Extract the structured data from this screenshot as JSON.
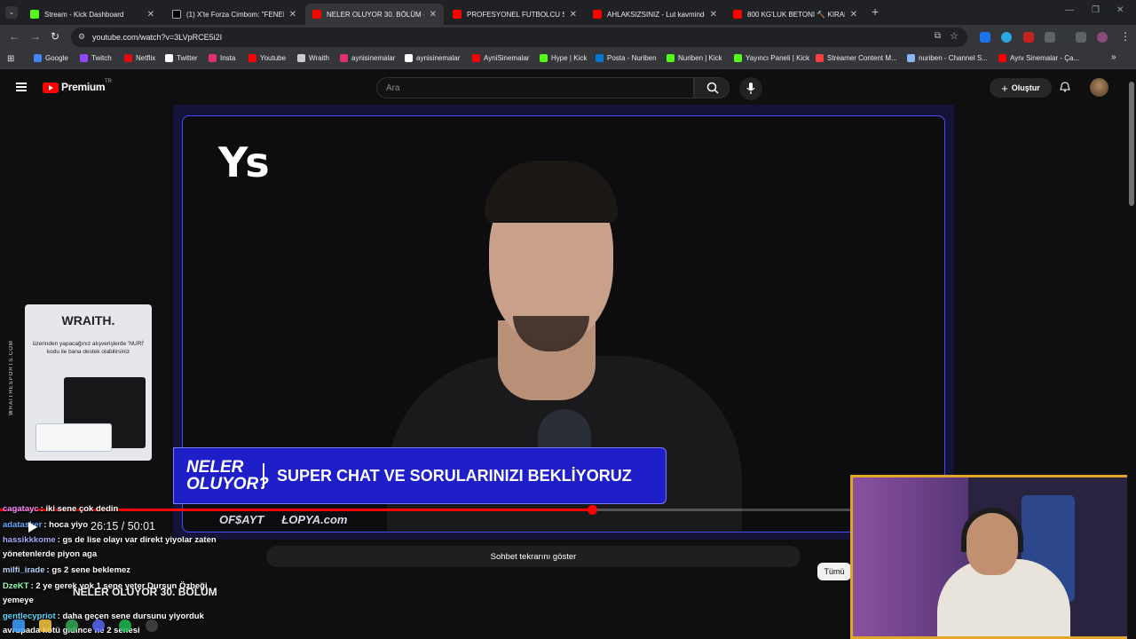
{
  "browser": {
    "tabs": [
      {
        "title": "Stream - Kick Dashboard",
        "color": "#53fc18"
      },
      {
        "title": "(1) X'te Forza Cimbom: \"FENER...",
        "color": "#ffffff"
      },
      {
        "title": "NELER OLUYOR 30. BÖLÜM - Y...",
        "color": "#ff0000"
      },
      {
        "title": "PROFESYONEL FUTBOLCU SEN...",
        "color": "#ff0000"
      },
      {
        "title": "AHLAKSIZSINIZ - Lut kavminde...",
        "color": "#ff0000"
      },
      {
        "title": "800 KG'LUK BETONI 🔨 KIRAR...",
        "color": "#ff0000"
      }
    ],
    "new_tab_label": "+",
    "url": "youtube.com/watch?v=3LVpRCE5i2I",
    "bookmarks": [
      {
        "label": "Google",
        "color": "#4285f4"
      },
      {
        "label": "Twitch",
        "color": "#9146ff"
      },
      {
        "label": "Netflix",
        "color": "#e50914"
      },
      {
        "label": "Twitter",
        "color": "#ffffff"
      },
      {
        "label": "Insta",
        "color": "#e1306c"
      },
      {
        "label": "Youtube",
        "color": "#ff0000"
      },
      {
        "label": "Wraith",
        "color": "#cccccc"
      },
      {
        "label": "aynisinemalar",
        "color": "#e1306c"
      },
      {
        "label": "aynisinemalar",
        "color": "#ffffff"
      },
      {
        "label": "AyniSinemalar",
        "color": "#ff0000"
      },
      {
        "label": "Hype | Kick",
        "color": "#53fc18"
      },
      {
        "label": "Posta - Nuriben",
        "color": "#0078d4"
      },
      {
        "label": "Nuriben | Kick",
        "color": "#53fc18"
      },
      {
        "label": "Yayıncı Paneli | Kick",
        "color": "#53fc18"
      },
      {
        "label": "Streamer Content M...",
        "color": "#ff4040"
      },
      {
        "label": "nuriben - Channel S...",
        "color": "#8ab4f8"
      },
      {
        "label": "Aynı Sinemalar - Ça...",
        "color": "#ff0000"
      }
    ],
    "overflow": "»"
  },
  "youtube": {
    "logo_text": "Premium",
    "region": "TR",
    "search_placeholder": "Ara",
    "create_label": "Oluştur"
  },
  "video": {
    "logo": "Ys",
    "show_name": "NELER OLUYOR?",
    "lower_third": "SUPER CHAT VE SORULARINIZI BEKLİYORUZ",
    "sponsors": [
      "OF$AYT",
      "ŁOPYA.com"
    ],
    "progress_fraction": 0.5237,
    "time": "26:15 / 50:01",
    "title": "NELER OLUYOR 30. BÖLÜM",
    "chat_replay_label": "Sohbet tekrarını göster",
    "chip_all": "Tümü"
  },
  "ad": {
    "brand": "WRAITH.",
    "side_text": "WRAITHESPORTS.COM",
    "text": "üzerinden yapacağınız alışverişlerde 'NURİ' kodu ile bana destek olabilirsiniz"
  },
  "chat": [
    {
      "user": "cagatayc",
      "color": "#e78cff",
      "text": ": iki sene çok dedin"
    },
    {
      "user": "adatasker",
      "color": "#6aa9ff",
      "text": ": hoca yiyo"
    },
    {
      "user": "hassikkkome",
      "color": "#a9a9ff",
      "text": ": gs de lise olayı var direkt yiyolar zaten"
    },
    {
      "user": "",
      "color": "#ffffff",
      "text": "yönetenlerde piyon aga"
    },
    {
      "user": "milfi_irade",
      "color": "#b9d6ff",
      "text": ": gs 2 sene beklemez"
    },
    {
      "user": "DzeKT",
      "color": "#8fffb3",
      "text": ": 2 ye gerek yok 1 sene yeter Dursun Özbeği"
    },
    {
      "user": "",
      "color": "#ffffff",
      "text": "yemeye"
    },
    {
      "user": "gentlecypriot",
      "color": "#59d9ff",
      "text": ": daha geçen sene dursunu yiyorduk"
    },
    {
      "user": "",
      "color": "#ffffff",
      "text": "avrupada kötü gidince ne 2 senesi"
    }
  ]
}
